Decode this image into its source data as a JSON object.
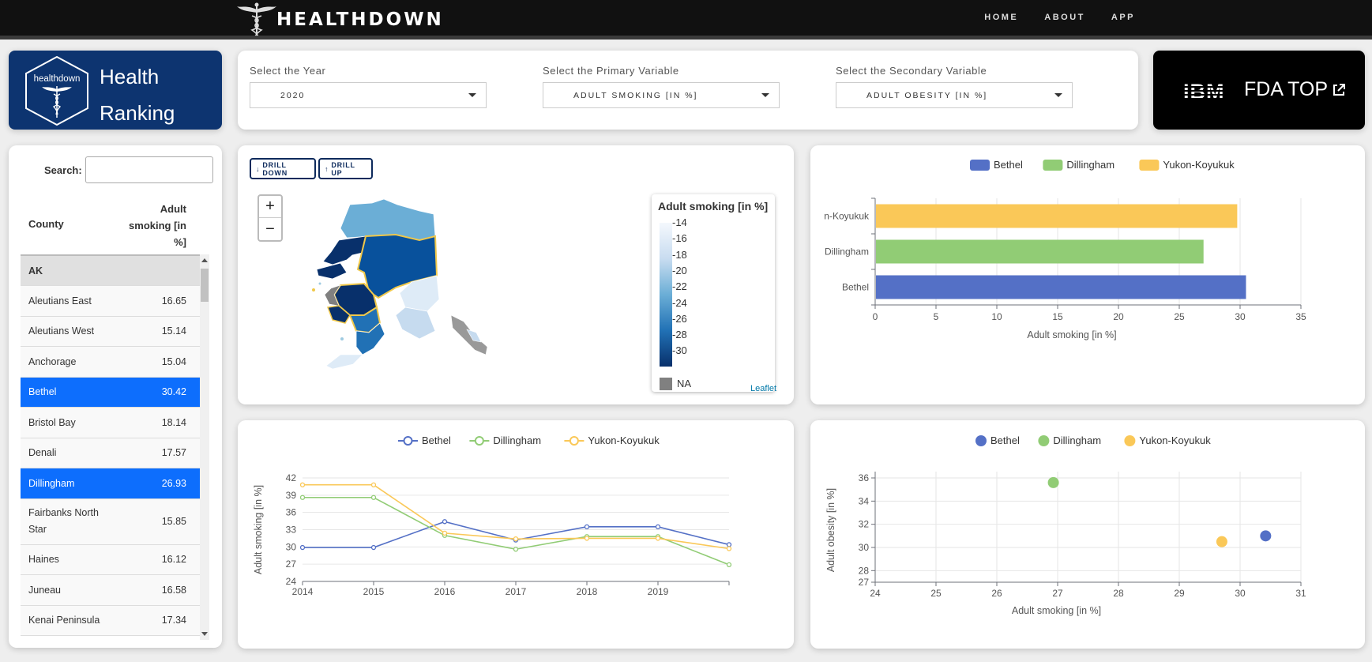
{
  "nav": {
    "brand": "HEALTHDOWN",
    "links": [
      "HOME",
      "ABOUT",
      "APP"
    ]
  },
  "rank_card": {
    "logo_text": "healthdown",
    "title_line1": "Health",
    "title_line2": "Ranking"
  },
  "selectors": {
    "year": {
      "label": "Select the Year",
      "value": "2020"
    },
    "primary": {
      "label": "Select the Primary Variable",
      "value": "ADULT SMOKING [IN %]"
    },
    "secondary": {
      "label": "Select the Secondary Variable",
      "value": "ADULT OBESITY [IN %]"
    }
  },
  "ibm_card": {
    "logo": "IBM",
    "link_label": "FDA TOP"
  },
  "table": {
    "search_label": "Search:",
    "search_value": "",
    "col_county": "County",
    "col_value": "Adult smoking [in %]",
    "rows": [
      {
        "county": "AK",
        "value": "",
        "group": true
      },
      {
        "county": "Aleutians East",
        "value": "16.65"
      },
      {
        "county": "Aleutians West",
        "value": "15.14"
      },
      {
        "county": "Anchorage",
        "value": "15.04"
      },
      {
        "county": "Bethel",
        "value": "30.42",
        "selected": true
      },
      {
        "county": "Bristol Bay",
        "value": "18.14"
      },
      {
        "county": "Denali",
        "value": "17.57"
      },
      {
        "county": "Dillingham",
        "value": "26.93",
        "selected": true
      },
      {
        "county": "Fairbanks North Star",
        "value": "15.85"
      },
      {
        "county": "Haines",
        "value": "16.12"
      },
      {
        "county": "Juneau",
        "value": "16.58"
      },
      {
        "county": "Kenai Peninsula",
        "value": "17.34"
      }
    ]
  },
  "map": {
    "drill_down": "DRILL DOWN",
    "drill_up": "DRILL UP",
    "zoom_in": "+",
    "zoom_out": "−",
    "legend_title": "Adult smoking [in %]",
    "legend_ticks": [
      "14",
      "16",
      "18",
      "20",
      "22",
      "24",
      "26",
      "28",
      "30"
    ],
    "na_label": "NA",
    "attribution": "Leaflet",
    "colors": {
      "light": "#deebf7",
      "mid": "#4292c6",
      "dark": "#08306b",
      "outline": "#f0c84a",
      "na": "#808080"
    }
  },
  "colors": {
    "Bethel": "#5470c6",
    "Dillingham": "#91cc75",
    "Yukon-Koyukuk": "#fac858"
  },
  "chart_data": [
    {
      "type": "bar",
      "orientation": "horizontal",
      "categories": [
        "Bethel",
        "Dillingham",
        "Yukon-Koyukuk"
      ],
      "values": [
        30.42,
        26.93,
        29.7
      ],
      "tick_labels": [
        "Bethel",
        "Dillingham",
        "n-Koyukuk"
      ],
      "legend": [
        "Bethel",
        "Dillingham",
        "Yukon-Koyukuk"
      ],
      "xlabel": "Adult smoking [in %]",
      "xlim": [
        0,
        35
      ],
      "xticks": [
        0,
        5,
        10,
        15,
        20,
        25,
        30,
        35
      ],
      "grid": true,
      "legend_position": "top"
    },
    {
      "type": "line",
      "x": [
        2014,
        2015,
        2016,
        2017,
        2018,
        2019,
        2020
      ],
      "xticks": [
        2014,
        2015,
        2016,
        2017,
        2018,
        2019
      ],
      "series": [
        {
          "name": "Bethel",
          "values": [
            29.9,
            29.9,
            34.4,
            31.2,
            33.5,
            33.5,
            30.4
          ]
        },
        {
          "name": "Dillingham",
          "values": [
            38.6,
            38.6,
            32.0,
            29.6,
            31.8,
            31.8,
            26.9
          ]
        },
        {
          "name": "Yukon-Koyukuk",
          "values": [
            40.8,
            40.8,
            32.4,
            31.4,
            31.5,
            31.5,
            29.7
          ]
        }
      ],
      "ylabel": "Adult smoking [in %]",
      "ylim": [
        24,
        42
      ],
      "yticks": [
        24,
        27,
        30,
        33,
        36,
        39,
        42
      ],
      "grid": true,
      "legend_position": "top"
    },
    {
      "type": "scatter",
      "series": [
        {
          "name": "Bethel",
          "x": 30.42,
          "y": 31.0
        },
        {
          "name": "Dillingham",
          "x": 26.93,
          "y": 35.6
        },
        {
          "name": "Yukon-Koyukuk",
          "x": 29.7,
          "y": 30.5
        }
      ],
      "xlabel": "Adult smoking [in %]",
      "ylabel": "Adult obesity [in %]",
      "xlim": [
        24,
        31
      ],
      "ylim": [
        27,
        36
      ],
      "xticks": [
        24,
        25,
        26,
        27,
        28,
        29,
        30,
        31
      ],
      "yticks": [
        27,
        28,
        30,
        32,
        34,
        36
      ],
      "grid": true,
      "legend_position": "top"
    }
  ]
}
